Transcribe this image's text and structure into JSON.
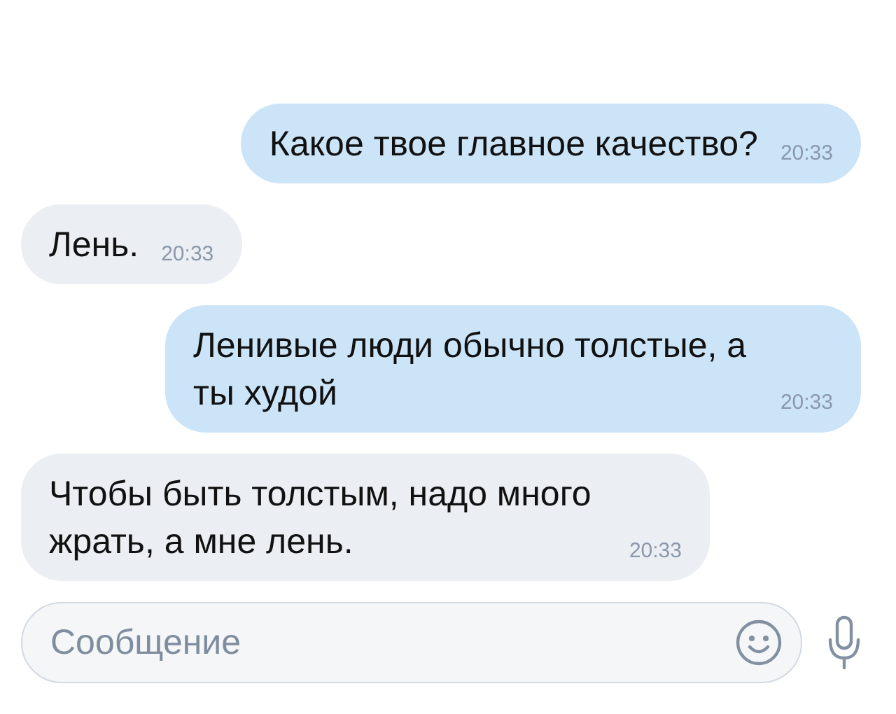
{
  "messages": [
    {
      "kind": "out",
      "text": "Какое твое главное качество?",
      "time": "20:33"
    },
    {
      "kind": "in",
      "text": "Лень.",
      "time": "20:33"
    },
    {
      "kind": "out",
      "text": "Ленивые люди обычно толстые, а ты худой",
      "time": "20:33"
    },
    {
      "kind": "in",
      "text": "Чтобы быть толстым, надо много жрать, а мне лень.",
      "time": "20:33"
    }
  ],
  "composer": {
    "placeholder": "Сообщение"
  }
}
